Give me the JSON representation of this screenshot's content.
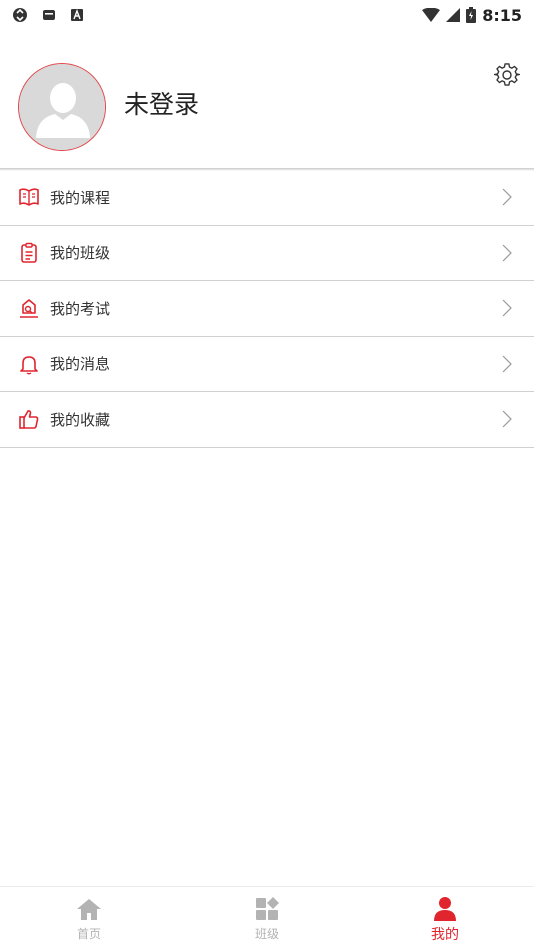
{
  "status_bar": {
    "time": "8:15"
  },
  "profile": {
    "username": "未登录"
  },
  "menu": {
    "items": [
      {
        "label": "我的课程",
        "icon": "book-icon"
      },
      {
        "label": "我的班级",
        "icon": "clipboard-icon"
      },
      {
        "label": "我的考试",
        "icon": "exam-icon"
      },
      {
        "label": "我的消息",
        "icon": "bell-icon"
      },
      {
        "label": "我的收藏",
        "icon": "thumbs-up-icon"
      }
    ]
  },
  "tabbar": {
    "tabs": [
      {
        "label": "首页",
        "icon": "home-icon",
        "active": false
      },
      {
        "label": "班级",
        "icon": "grid-icon",
        "active": false
      },
      {
        "label": "我的",
        "icon": "user-icon",
        "active": true
      }
    ]
  },
  "colors": {
    "accent": "#e0252f",
    "inactive": "#b3b3b3",
    "divider": "#d0d0d0"
  }
}
